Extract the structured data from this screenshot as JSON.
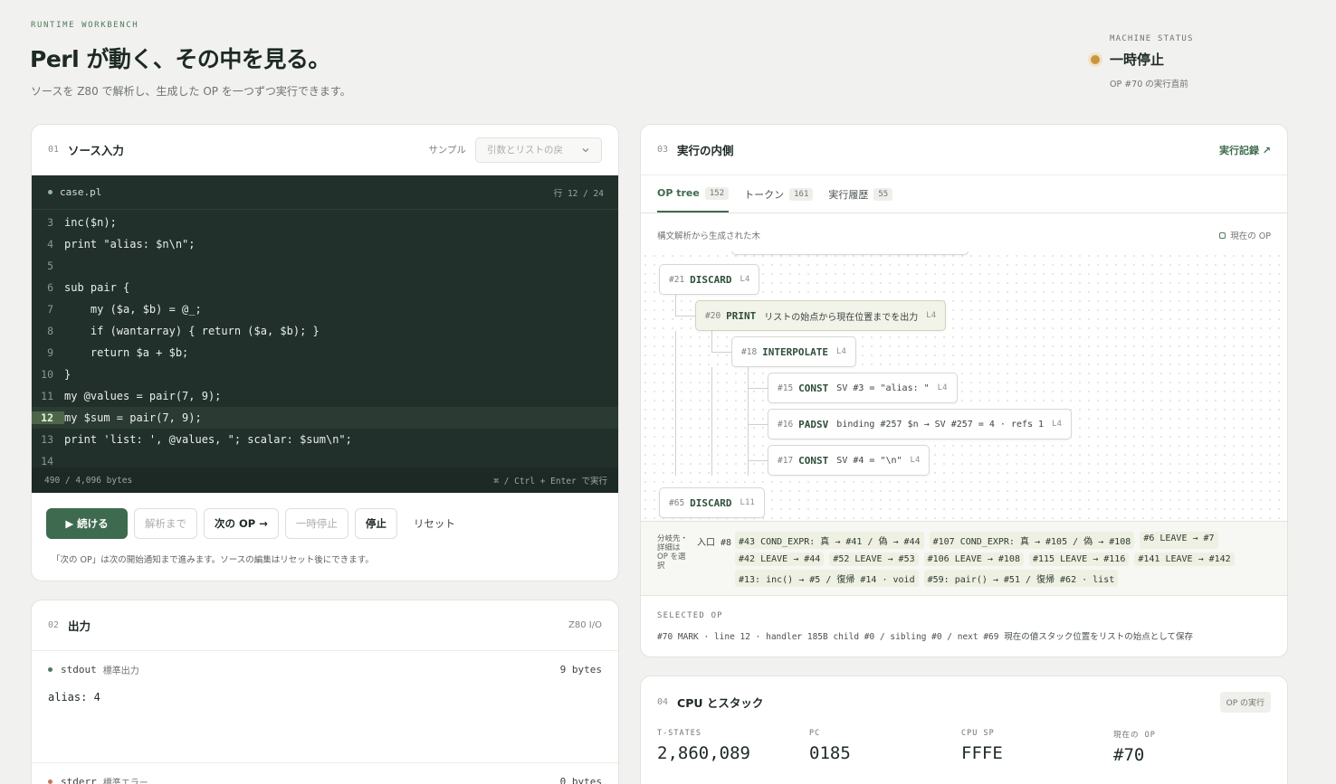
{
  "header": {
    "eyebrow": "RUNTIME WORKBENCH",
    "title": "Perl が動く、その中を見る。",
    "subtitle": "ソースを Z80 で解析し、生成した OP を一つずつ実行できます。"
  },
  "machine_status": {
    "label": "MACHINE STATUS",
    "value": "一時停止",
    "detail": "OP #70 の実行直前",
    "color": "#c9963e"
  },
  "source": {
    "num": "01",
    "title": "ソース入力",
    "sample_label": "サンプル",
    "sample_value": "引数とリストの戻",
    "filename": "case.pl",
    "position": "行 12 / 24",
    "lines": [
      {
        "n": "3",
        "code": "inc($n);"
      },
      {
        "n": "4",
        "code": "print \"alias: $n\\n\";"
      },
      {
        "n": "5",
        "code": ""
      },
      {
        "n": "6",
        "code": "sub pair {"
      },
      {
        "n": "7",
        "code": "    my ($a, $b) = @_;"
      },
      {
        "n": "8",
        "code": "    if (wantarray) { return ($a, $b); }"
      },
      {
        "n": "9",
        "code": "    return $a + $b;"
      },
      {
        "n": "10",
        "code": "}"
      },
      {
        "n": "11",
        "code": "my @values = pair(7, 9);"
      },
      {
        "n": "12",
        "code": "my $sum = pair(7, 9);"
      },
      {
        "n": "13",
        "code": "print 'list: ', @values, \"; scalar: $sum\\n\";"
      },
      {
        "n": "14",
        "code": ""
      }
    ],
    "current_line": "12",
    "bytes": "490 / 4,096 bytes",
    "shortcut": "⌘ / Ctrl + Enter で実行",
    "buttons": {
      "continue": "▶ 続ける",
      "until_parse": "解析まで",
      "next_op": "次の OP →",
      "pause": "一時停止",
      "stop": "停止",
      "reset": "リセット"
    },
    "hint": "「次の OP」は次の開始通知まで進みます。ソースの編集はリセット後にできます。"
  },
  "output": {
    "num": "02",
    "title": "出力",
    "io": "Z80 I/O",
    "stdout": {
      "name": "stdout",
      "jp": "標準出力",
      "bytes": "9 bytes",
      "text": "alias: 4"
    },
    "stderr": {
      "name": "stderr",
      "jp": "標準エラー",
      "bytes": "0 bytes"
    }
  },
  "execution": {
    "num": "03",
    "title": "実行の内側",
    "link": "実行記録 ↗",
    "tabs": [
      {
        "label": "OP tree",
        "count": "152"
      },
      {
        "label": "トークン",
        "count": "161"
      },
      {
        "label": "実行履歴",
        "count": "55"
      }
    ],
    "tree_caption": "構文解析から生成された木",
    "current_op_label": "現在の OP",
    "nodes": [
      {
        "id": "#21",
        "op": "DISCARD",
        "desc": "",
        "line": "L4"
      },
      {
        "id": "#20",
        "op": "PRINT",
        "desc": "リストの始点から現在位置までを出力",
        "line": "L4"
      },
      {
        "id": "#18",
        "op": "INTERPOLATE",
        "desc": "",
        "line": "L4"
      },
      {
        "id": "#15",
        "op": "CONST",
        "desc": "SV #3 = \"alias: \"",
        "line": "L4"
      },
      {
        "id": "#16",
        "op": "PADSV",
        "desc": "binding #257 $n → SV #257 = 4 · refs 1",
        "line": "L4"
      },
      {
        "id": "#17",
        "op": "CONST",
        "desc": "SV #4 = \"\\n\"",
        "line": "L4"
      },
      {
        "id": "#65",
        "op": "DISCARD",
        "desc": "",
        "line": "L11"
      }
    ],
    "branch_label": "分岐先・詳細はOP を選択",
    "entry": "入口 #8",
    "branches": [
      "#43 COND_EXPR: 真 → #41 / 偽 → #44",
      "#107 COND_EXPR: 真 → #105 / 偽 → #108",
      "#6 LEAVE → #7",
      "#42 LEAVE → #44",
      "#52 LEAVE → #53",
      "#106 LEAVE → #108",
      "#115 LEAVE → #116",
      "#141 LEAVE → #142",
      "#13: inc() → #5 / 復帰 #14 · void",
      "#59: pair() → #51 / 復帰 #62 · list"
    ],
    "selected_label": "SELECTED OP",
    "selected_value": "#70 MARK · line 12 · handler 185B child #0 / sibling #0 / next #69",
    "selected_desc": "現在の値スタック位置をリストの始点として保存"
  },
  "cpu": {
    "num": "04",
    "title": "CPU とスタック",
    "pill": "OP の実行",
    "metrics": [
      {
        "label": "T-STATES",
        "value": "2,860,089"
      },
      {
        "label": "PC",
        "value": "0185"
      },
      {
        "label": "CPU SP",
        "value": "FFFE"
      },
      {
        "label": "現在の OP",
        "value": "#70"
      }
    ]
  }
}
